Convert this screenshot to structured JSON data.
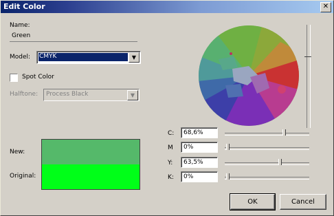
{
  "window": {
    "title": "Edit Color",
    "close_label": "✕"
  },
  "name": {
    "label": "Name:",
    "value": "Green"
  },
  "model": {
    "label": "Model:",
    "value": "CMYK"
  },
  "spot_color": {
    "label": "Spot Color",
    "checked": false
  },
  "halftone": {
    "label": "Halftone:",
    "value": "Process Black"
  },
  "preview": {
    "new_label": "New:",
    "original_label": "Original:",
    "new_color": "#55b96a",
    "original_color": "#00ff18"
  },
  "channels": [
    {
      "label": "C:",
      "value": "68,6%",
      "level": 0.686
    },
    {
      "label": "M",
      "value": "0%",
      "level": 0.0
    },
    {
      "label": "Y:",
      "value": "63,5%",
      "level": 0.635
    },
    {
      "label": "K:",
      "value": "0%",
      "level": 0.0
    }
  ],
  "buttons": {
    "ok": "OK",
    "cancel": "Cancel"
  }
}
